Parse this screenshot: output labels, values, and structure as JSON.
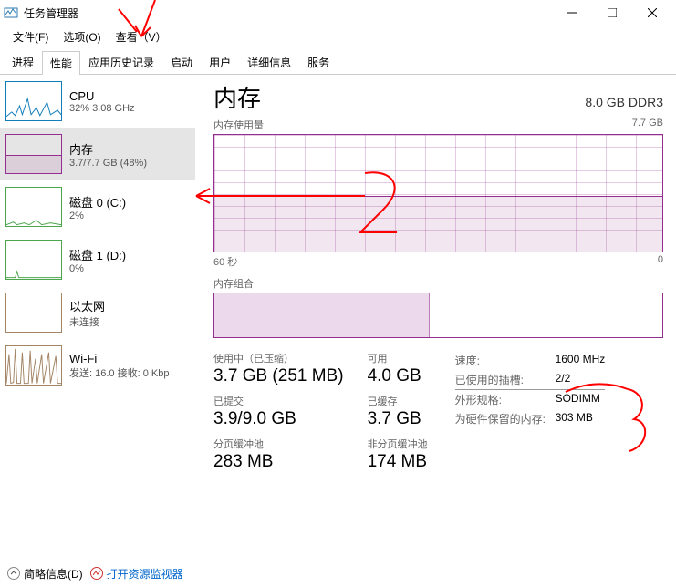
{
  "window": {
    "title": "任务管理器"
  },
  "menu": {
    "file": "文件(F)",
    "options": "选项(O)",
    "view": "查看（V）"
  },
  "tabs": {
    "processes": "进程",
    "performance": "性能",
    "apphistory": "应用历史记录",
    "startup": "启动",
    "users": "用户",
    "details": "详细信息",
    "services": "服务"
  },
  "sidebar": {
    "cpu": {
      "title": "CPU",
      "sub": "32%  3.08 GHz"
    },
    "mem": {
      "title": "内存",
      "sub": "3.7/7.7 GB (48%)"
    },
    "disk0": {
      "title": "磁盘 0 (C:)",
      "sub": "2%"
    },
    "disk1": {
      "title": "磁盘 1 (D:)",
      "sub": "0%"
    },
    "eth": {
      "title": "以太网",
      "sub": "未连接"
    },
    "wifi": {
      "title": "Wi-Fi",
      "sub": "发送: 16.0  接收: 0 Kbp"
    }
  },
  "main": {
    "heading": "内存",
    "spec": "8.0 GB DDR3",
    "usage_label": "内存使用量",
    "usage_max": "7.7 GB",
    "axis_left": "60 秒",
    "axis_right": "0",
    "comp_label": "内存组合"
  },
  "stats": {
    "in_use": {
      "label": "使用中（已压缩）",
      "value": "3.7 GB (251 MB)"
    },
    "available": {
      "label": "可用",
      "value": "4.0 GB"
    },
    "committed": {
      "label": "已提交",
      "value": "3.9/9.0 GB"
    },
    "cached": {
      "label": "已缓存",
      "value": "3.7 GB"
    },
    "paged": {
      "label": "分页缓冲池",
      "value": "283 MB"
    },
    "nonpaged": {
      "label": "非分页缓冲池",
      "value": "174 MB"
    }
  },
  "right": {
    "speed": {
      "k": "速度:",
      "v": "1600 MHz"
    },
    "slots": {
      "k": "已使用的插槽:",
      "v": "2/2"
    },
    "form": {
      "k": "外形规格:",
      "v": "SODIMM"
    },
    "hw": {
      "k": "为硬件保留的内存:",
      "v": "303 MB"
    }
  },
  "footer": {
    "brief": "简略信息(D)",
    "resmon": "打开资源监视器"
  }
}
